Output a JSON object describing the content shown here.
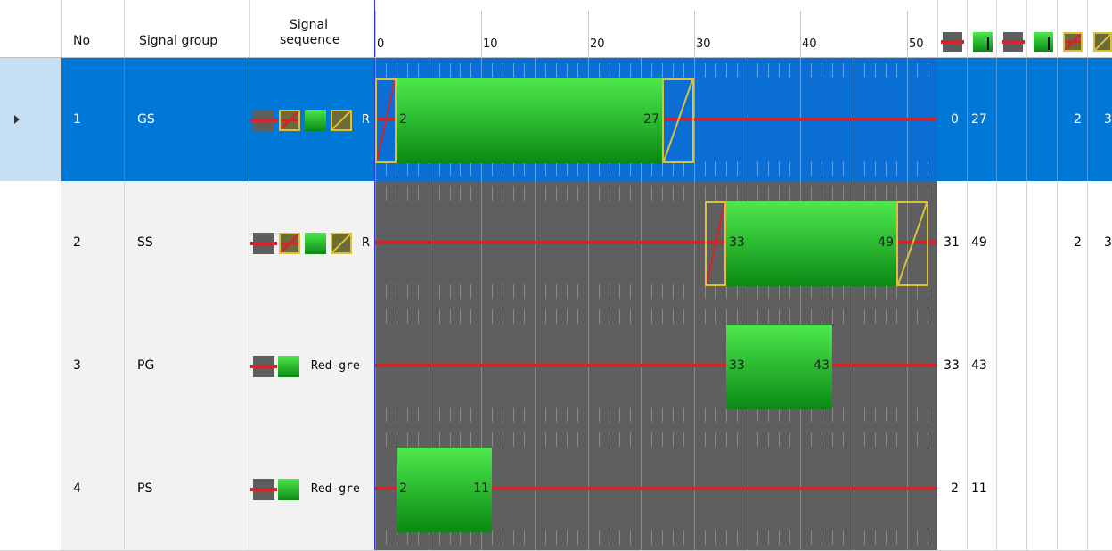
{
  "header": {
    "col_no": "No",
    "col_group": "Signal group",
    "col_seq_line1": "Signal",
    "col_seq_line2": "sequence",
    "ticks": [
      "0",
      "10",
      "20",
      "30",
      "40",
      "50"
    ]
  },
  "rows": [
    {
      "no": "1",
      "group": "GS",
      "seq_label": "R",
      "green_start": "2",
      "green_end": "27",
      "col_a": "0",
      "col_b": "27",
      "col_c": "2",
      "col_d": "3",
      "selected": true
    },
    {
      "no": "2",
      "group": "SS",
      "seq_label": "R",
      "green_start": "33",
      "green_end": "49",
      "col_a": "31",
      "col_b": "49",
      "col_c": "2",
      "col_d": "3",
      "selected": false
    },
    {
      "no": "3",
      "group": "PG",
      "seq_label": "Red-gre",
      "green_start": "33",
      "green_end": "43",
      "col_a": "33",
      "col_b": "43",
      "col_c": "",
      "col_d": "",
      "selected": false
    },
    {
      "no": "4",
      "group": "PS",
      "seq_label": "Red-gre",
      "green_start": "2",
      "green_end": "11",
      "col_a": "2",
      "col_b": "11",
      "col_c": "",
      "col_d": "",
      "selected": false
    }
  ],
  "colors": {
    "selected_row": "#0078d7",
    "timeline_bg": "#5f5f5f",
    "green_top": "#4de84d",
    "green_bottom": "#0a8a14",
    "red_line": "#d3242b",
    "amber": "#d9c23a"
  }
}
